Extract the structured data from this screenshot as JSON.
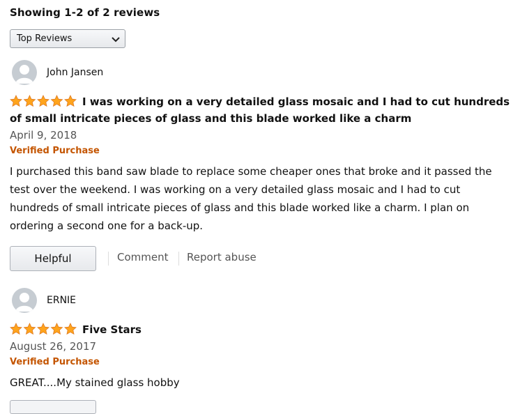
{
  "header": {
    "showing": "Showing 1-2 of 2 reviews"
  },
  "sort": {
    "selected": "Top Reviews"
  },
  "reviews": [
    {
      "reviewer": "John Jansen",
      "rating": 5,
      "title": "I was working on a very detailed glass mosaic and I had to cut hundreds of small intricate pieces of glass and this blade worked like a charm",
      "date": "April 9, 2018",
      "verified": "Verified Purchase",
      "body": "I purchased this band saw blade to replace some cheaper ones that broke and it passed the test over the weekend. I was working on a very detailed glass mosaic and I had to cut hundreds of small intricate pieces of glass and this blade worked like a charm. I plan on ordering a second one for a back-up.",
      "helpful_label": "Helpful",
      "comment_label": "Comment",
      "report_label": "Report abuse"
    },
    {
      "reviewer": "ERNIE",
      "rating": 5,
      "title": "Five Stars",
      "date": "August 26, 2017",
      "verified": "Verified Purchase",
      "body": "GREAT....My stained glass hobby"
    }
  ],
  "colors": {
    "star": "#ffa41c",
    "verified": "#c45500",
    "link": "#555555"
  },
  "icons": {
    "avatar": "user-avatar-icon",
    "dropdown": "chevron-down-icon",
    "rating": "star-icon"
  }
}
